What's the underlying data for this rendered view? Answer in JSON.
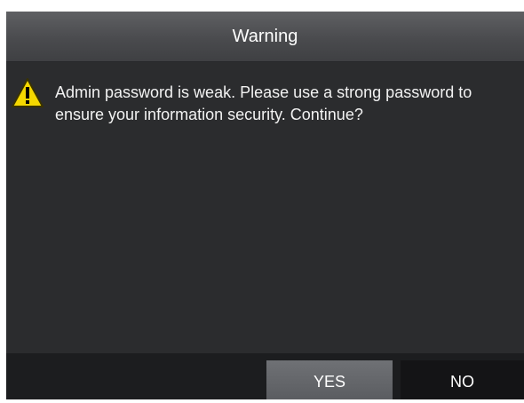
{
  "dialog": {
    "title": "Warning",
    "icon": "warning-icon",
    "message": "Admin password is weak. Please use a strong password to ensure your information security. Continue?",
    "buttons": {
      "yes_label": "YES",
      "no_label": "NO"
    },
    "colors": {
      "warning_yellow": "#f5d800",
      "background": "#2b2c2e",
      "titlebar": "#4a4b4e",
      "selected_button": "#5f6164"
    }
  }
}
